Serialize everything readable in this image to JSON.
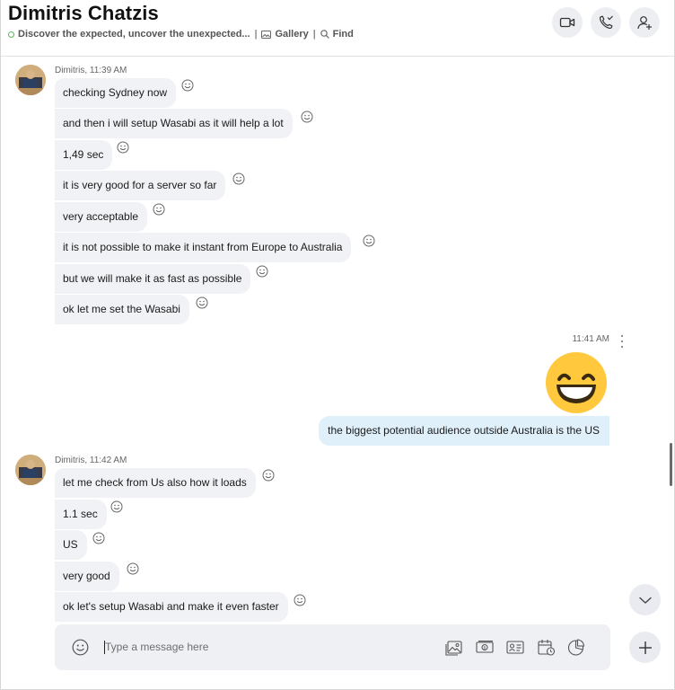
{
  "header": {
    "title": "Dimitris Chatzis",
    "mood": "Discover the expected, uncover the unexpected...",
    "separator": "|",
    "gallery_label": "Gallery",
    "find_label": "Find",
    "status_color": "#5cb85c"
  },
  "icons": {
    "video_call": "video-camera-icon",
    "audio_call": "phone-icon",
    "add_people": "add-person-icon",
    "react": "smiley-icon",
    "scroll_down": "chevron-down-icon",
    "emoji": "smiley-icon",
    "media": "image-icon",
    "money": "money-icon",
    "contact": "contact-card-icon",
    "schedule": "calendar-icon",
    "poll": "poll-icon",
    "more": "plus-icon"
  },
  "conversation": {
    "groups": [
      {
        "sender": "Dimitris",
        "timestamp": "Dimitris, 11:39 AM",
        "messages": [
          "checking Sydney now",
          "and then i will setup Wasabi as it will help a lot",
          "1,49 sec",
          "it is very good for a server so far",
          "very acceptable",
          "it is not possible to make it instant from Europe to Australia",
          "but we will make it as fast as possible",
          "ok let me set the Wasabi"
        ]
      },
      {
        "sender": "me",
        "timestamp": "11:41 AM",
        "emoji": "grinning-face-emoji",
        "messages": [
          "the biggest potential audience outside Australia is the US"
        ]
      },
      {
        "sender": "Dimitris",
        "timestamp": "Dimitris, 11:42 AM",
        "messages": [
          "let me check from Us also how it loads",
          "1.1 sec",
          "US",
          "very good",
          "ok let's setup Wasabi and make it even faster"
        ]
      }
    ]
  },
  "composer": {
    "placeholder": "Type a message here",
    "value": ""
  },
  "colors": {
    "incoming_bubble": "#f1f2f5",
    "outgoing_bubble": "#dff0fb",
    "button_bg": "#eceef2"
  }
}
